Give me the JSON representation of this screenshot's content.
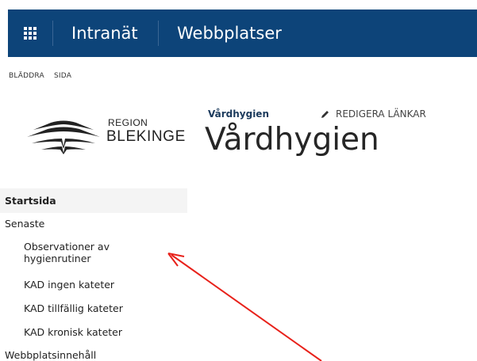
{
  "suitebar": {
    "nav_links": [
      "Intranät",
      "Webbplatser"
    ],
    "background_color": "#0d4479"
  },
  "ribbon": {
    "tabs": [
      "BLÄDDRA",
      "SIDA"
    ]
  },
  "logo": {
    "line1": "REGION",
    "line2": "BLEKINGE"
  },
  "header": {
    "breadcrumb": "Vårdhygien",
    "edit_links_label": "REDIGERA LÄNKAR",
    "page_title": "Vårdhygien"
  },
  "quicklaunch": {
    "items": [
      {
        "label": "Startsida"
      },
      {
        "label": "Senaste"
      },
      {
        "label": "Observationer av hygienrutiner"
      },
      {
        "label": "KAD ingen kateter"
      },
      {
        "label": "KAD tillfällig kateter"
      },
      {
        "label": "KAD kronisk kateter"
      },
      {
        "label": "Webbplatsinnehåll"
      }
    ]
  },
  "annotation": {
    "color": "#e8211a",
    "icon": "red-arrow"
  }
}
